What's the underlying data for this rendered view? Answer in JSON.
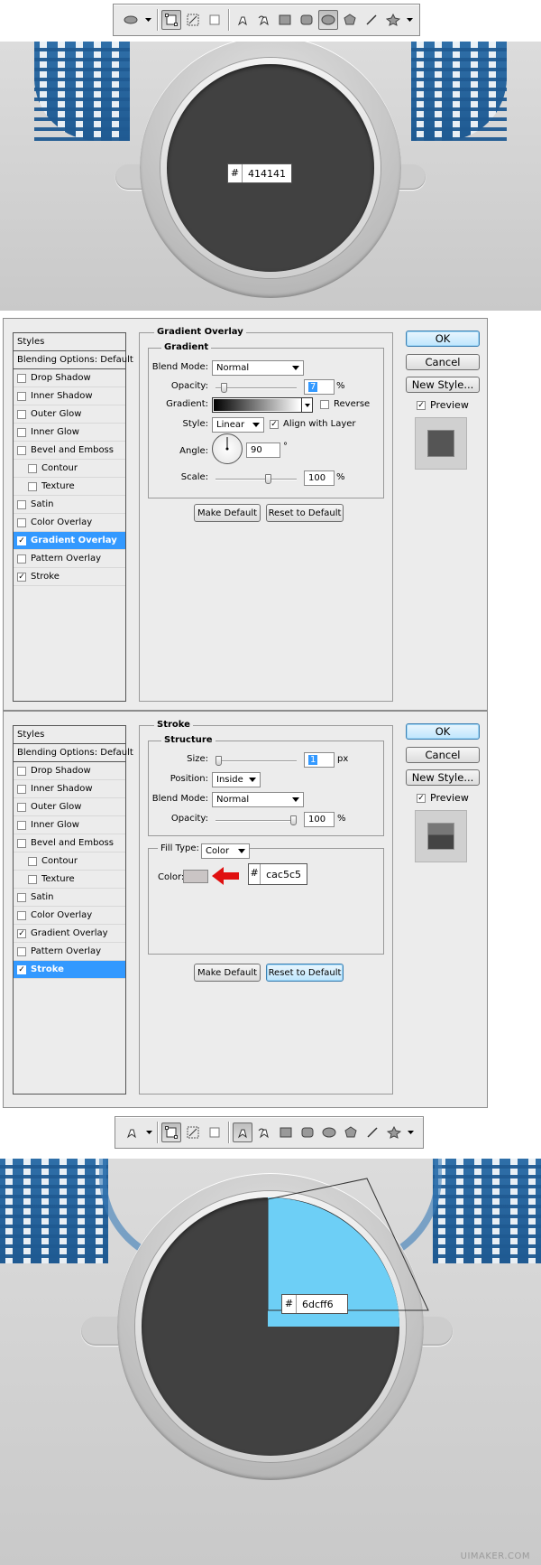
{
  "toolbar_top": {
    "tools": [
      "ellipse-tool-icon",
      "dropdown-arrow-icon",
      "shape-layers-icon",
      "paths-icon",
      "fill-pixels-icon",
      "pen-icon",
      "freeform-pen-icon",
      "rectangle-icon",
      "rounded-rectangle-icon",
      "ellipse-icon",
      "polygon-icon",
      "line-icon",
      "custom-shape-icon",
      "dropdown-arrow-icon"
    ]
  },
  "scene_top": {
    "swatch": {
      "hash": "#",
      "value": "414141"
    },
    "disc_color": "#414141"
  },
  "dialog_gradient": {
    "styles_header": "Styles",
    "blending_options": "Blending Options: Default",
    "styles": [
      {
        "label": "Drop Shadow",
        "checked": false,
        "sub": false
      },
      {
        "label": "Inner Shadow",
        "checked": false,
        "sub": false
      },
      {
        "label": "Outer Glow",
        "checked": false,
        "sub": false
      },
      {
        "label": "Inner Glow",
        "checked": false,
        "sub": false
      },
      {
        "label": "Bevel and Emboss",
        "checked": false,
        "sub": false
      },
      {
        "label": "Contour",
        "checked": false,
        "sub": true
      },
      {
        "label": "Texture",
        "checked": false,
        "sub": true
      },
      {
        "label": "Satin",
        "checked": false,
        "sub": false
      },
      {
        "label": "Color Overlay",
        "checked": false,
        "sub": false
      },
      {
        "label": "Gradient Overlay",
        "checked": true,
        "sub": false,
        "selected": true
      },
      {
        "label": "Pattern Overlay",
        "checked": false,
        "sub": false
      },
      {
        "label": "Stroke",
        "checked": true,
        "sub": false
      }
    ],
    "section_title": "Gradient Overlay",
    "group_title": "Gradient",
    "blend_mode_label": "Blend Mode:",
    "blend_mode": "Normal",
    "opacity_label": "Opacity:",
    "opacity_value": "7",
    "opacity_level": 0.07,
    "percent": "%",
    "gradient_label": "Gradient:",
    "reverse_label": "Reverse",
    "reverse_checked": false,
    "style_label": "Style:",
    "style_value": "Linear",
    "align_label": "Align with Layer",
    "align_checked": true,
    "angle_label": "Angle:",
    "angle_value": "90",
    "degree": "°",
    "scale_label": "Scale:",
    "scale_value": "100",
    "scale_level": 0.667,
    "make_default": "Make Default",
    "reset_default": "Reset to Default",
    "ok": "OK",
    "cancel": "Cancel",
    "new_style": "New Style...",
    "preview_label": "Preview",
    "preview_checked": true
  },
  "dialog_stroke": {
    "styles_header": "Styles",
    "blending_options": "Blending Options: Default",
    "styles": [
      {
        "label": "Drop Shadow",
        "checked": false,
        "sub": false
      },
      {
        "label": "Inner Shadow",
        "checked": false,
        "sub": false
      },
      {
        "label": "Outer Glow",
        "checked": false,
        "sub": false
      },
      {
        "label": "Inner Glow",
        "checked": false,
        "sub": false
      },
      {
        "label": "Bevel and Emboss",
        "checked": false,
        "sub": false
      },
      {
        "label": "Contour",
        "checked": false,
        "sub": true
      },
      {
        "label": "Texture",
        "checked": false,
        "sub": true
      },
      {
        "label": "Satin",
        "checked": false,
        "sub": false
      },
      {
        "label": "Color Overlay",
        "checked": false,
        "sub": false
      },
      {
        "label": "Gradient Overlay",
        "checked": true,
        "sub": false
      },
      {
        "label": "Pattern Overlay",
        "checked": false,
        "sub": false
      },
      {
        "label": "Stroke",
        "checked": true,
        "sub": false,
        "selected": true
      }
    ],
    "section_title": "Stroke",
    "group_title": "Structure",
    "size_label": "Size:",
    "size_value": "1",
    "size_unit": "px",
    "size_level": 0.0,
    "position_label": "Position:",
    "position_value": "Inside",
    "blend_mode_label": "Blend Mode:",
    "blend_mode": "Normal",
    "opacity_label": "Opacity:",
    "opacity_value": "100",
    "opacity_level": 1.0,
    "percent": "%",
    "fill_type_label": "Fill Type:",
    "fill_type": "Color",
    "color_label": "Color:",
    "color_swatch": "#cac5c5",
    "swatch": {
      "hash": "#",
      "value": "cac5c5"
    },
    "make_default": "Make Default",
    "reset_default": "Reset to Default",
    "ok": "OK",
    "cancel": "Cancel",
    "new_style": "New Style...",
    "preview_label": "Preview",
    "preview_checked": true
  },
  "toolbar_bottom": {
    "tools": [
      "pen-tool-icon",
      "dropdown-arrow-icon",
      "shape-layers-icon",
      "paths-icon",
      "fill-pixels-icon",
      "pen-icon",
      "freeform-pen-icon",
      "rectangle-icon",
      "rounded-rectangle-icon",
      "ellipse-icon",
      "polygon-icon",
      "line-icon",
      "custom-shape-icon",
      "dropdown-arrow-icon"
    ]
  },
  "scene_bottom": {
    "swatch": {
      "hash": "#",
      "value": "6dcff6"
    },
    "highlight_color": "#6dcff6",
    "disc_color": "#414141"
  },
  "watermark": "UIMAKER.COM",
  "colors": {
    "accent_selected": "#3399ff",
    "arrow": "#e01010"
  }
}
